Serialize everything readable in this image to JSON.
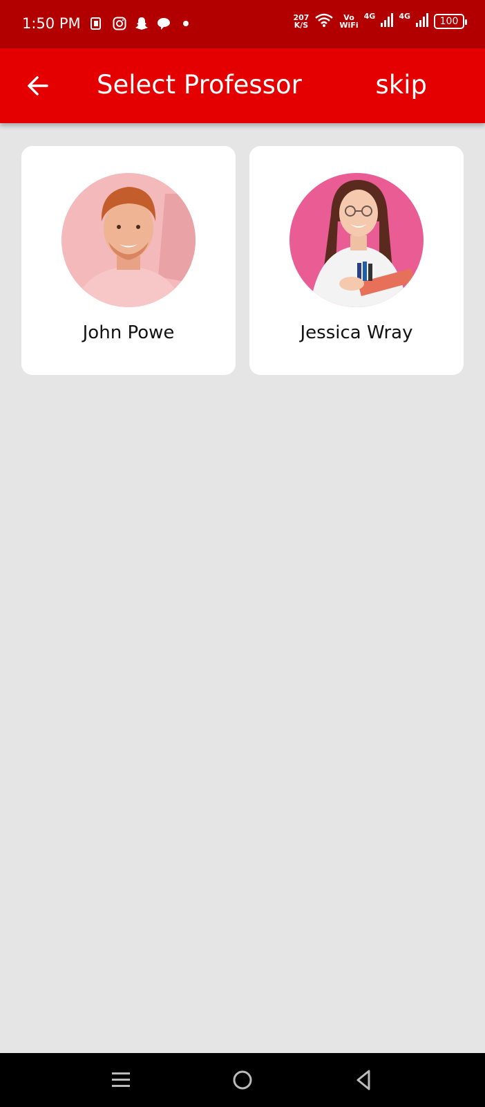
{
  "status_bar": {
    "time": "1:50 PM",
    "speed_value": "207",
    "speed_unit": "K/S",
    "vowifi_top": "Vo",
    "vowifi_bottom": "WiFi",
    "net1": "4G",
    "net2": "4G",
    "battery": "100",
    "left_icons": [
      "app-notification-icon",
      "instagram-icon",
      "snapchat-icon",
      "chat-icon",
      "dot-icon"
    ]
  },
  "app_bar": {
    "title": "Select Professor",
    "skip_label": "skip",
    "background": "#e50000"
  },
  "professors": [
    {
      "name": "John Powe",
      "avatar_bg": "#f4b9bb"
    },
    {
      "name": "Jessica Wray",
      "avatar_bg": "#ea5d94"
    }
  ],
  "nav": {
    "icons": [
      "recent-apps-icon",
      "home-icon",
      "back-nav-icon"
    ]
  }
}
